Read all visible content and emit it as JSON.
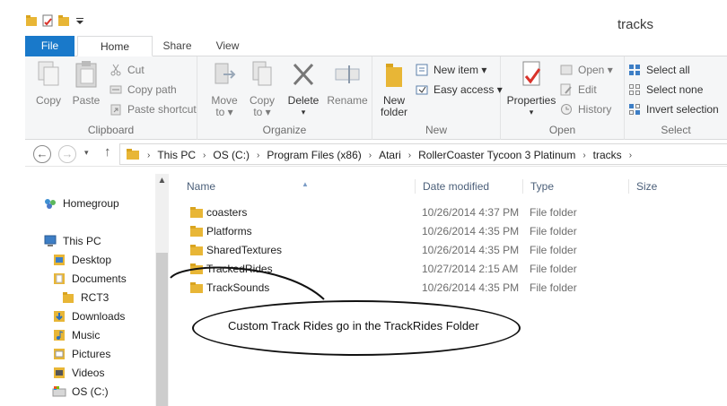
{
  "window": {
    "title": "tracks"
  },
  "ribbon": {
    "tabs": {
      "file": "File",
      "home": "Home",
      "share": "Share",
      "view": "View"
    },
    "clipboard": {
      "label": "Clipboard",
      "copy": "Copy",
      "paste": "Paste",
      "cut": "Cut",
      "copy_path": "Copy path",
      "paste_shortcut": "Paste shortcut"
    },
    "organize": {
      "label": "Organize",
      "move_to_1": "Move",
      "move_to_2": "to ▾",
      "copy_to_1": "Copy",
      "copy_to_2": "to ▾",
      "delete": "Delete",
      "delete_caret": "▾",
      "rename": "Rename"
    },
    "new": {
      "label": "New",
      "new_folder_1": "New",
      "new_folder_2": "folder",
      "new_item": "New item ▾",
      "easy_access": "Easy access ▾"
    },
    "open": {
      "label": "Open",
      "properties": "Properties",
      "properties_caret": "▾",
      "open": "Open ▾",
      "edit": "Edit",
      "history": "History"
    },
    "select": {
      "label": "Select",
      "select_all": "Select all",
      "select_none": "Select none",
      "invert_selection": "Invert selection"
    }
  },
  "address": {
    "back": "←",
    "forward": "→",
    "recent": "▾",
    "up": "↑",
    "crumbs": [
      "This PC",
      "OS (C:)",
      "Program Files (x86)",
      "Atari",
      "RollerCoaster Tycoon 3 Platinum",
      "tracks"
    ],
    "sep": "›"
  },
  "nav": {
    "items": [
      {
        "label": "Homegroup"
      },
      {
        "label": "This PC"
      },
      {
        "label": "Desktop"
      },
      {
        "label": "Documents"
      },
      {
        "label": "RCT3"
      },
      {
        "label": "Downloads"
      },
      {
        "label": "Music"
      },
      {
        "label": "Pictures"
      },
      {
        "label": "Videos"
      },
      {
        "label": "OS (C:)"
      }
    ]
  },
  "columns": {
    "name": "Name",
    "date": "Date modified",
    "type": "Type",
    "size": "Size"
  },
  "files": [
    {
      "name": "coasters",
      "date": "10/26/2014 4:37 PM",
      "type": "File folder"
    },
    {
      "name": "Platforms",
      "date": "10/26/2014 4:35 PM",
      "type": "File folder"
    },
    {
      "name": "SharedTextures",
      "date": "10/26/2014 4:35 PM",
      "type": "File folder"
    },
    {
      "name": "TrackedRides",
      "date": "10/27/2014 2:15 AM",
      "type": "File folder"
    },
    {
      "name": "TrackSounds",
      "date": "10/26/2014 4:35 PM",
      "type": "File folder"
    }
  ],
  "annotation": {
    "text": "Custom Track Rides go in the TrackRides Folder"
  },
  "colors": {
    "file_tab": "#1979ca",
    "folder": "#e8b636"
  }
}
